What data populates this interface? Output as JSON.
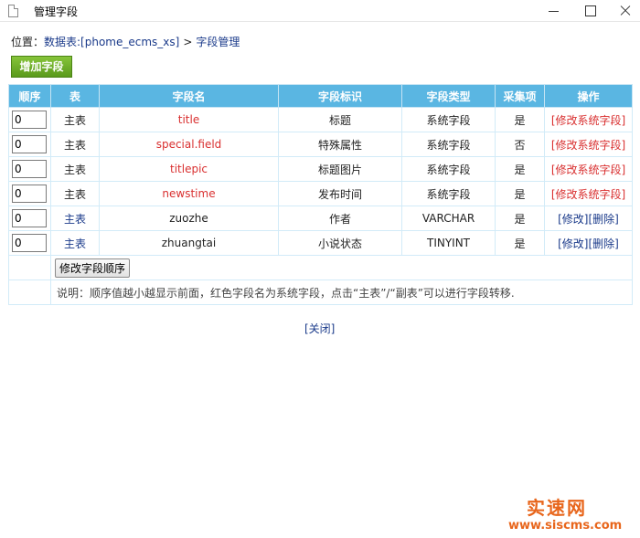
{
  "window": {
    "title": "管理字段"
  },
  "breadcrumb": {
    "prefix": "位置：",
    "db_link": "数据表:[phome_ecms_xs]",
    "separator": ">",
    "current": "字段管理"
  },
  "toolbar": {
    "add_label": "增加字段"
  },
  "table": {
    "headers": [
      "顺序",
      "表",
      "字段名",
      "字段标识",
      "字段类型",
      "采集项",
      "操作"
    ],
    "rows": [
      {
        "order": "0",
        "table": "主表",
        "name": "title",
        "label": "标题",
        "type": "系统字段",
        "collect": "是",
        "system": true,
        "op_sys": "[修改系统字段]"
      },
      {
        "order": "0",
        "table": "主表",
        "name": "special.field",
        "label": "特殊属性",
        "type": "系统字段",
        "collect": "否",
        "system": true,
        "op_sys": "[修改系统字段]"
      },
      {
        "order": "0",
        "table": "主表",
        "name": "titlepic",
        "label": "标题图片",
        "type": "系统字段",
        "collect": "是",
        "system": true,
        "op_sys": "[修改系统字段]"
      },
      {
        "order": "0",
        "table": "主表",
        "name": "newstime",
        "label": "发布时间",
        "type": "系统字段",
        "collect": "是",
        "system": true,
        "op_sys": "[修改系统字段]"
      },
      {
        "order": "0",
        "table": "主表",
        "name": "zuozhe",
        "label": "作者",
        "type": "VARCHAR",
        "collect": "是",
        "system": false,
        "op_edit": "[修改]",
        "op_delete": "[删除]"
      },
      {
        "order": "0",
        "table": "主表",
        "name": "zhuangtai",
        "label": "小说状态",
        "type": "TINYINT",
        "collect": "是",
        "system": false,
        "op_edit": "[修改]",
        "op_delete": "[删除]"
      }
    ],
    "submit_label": "修改字段顺序",
    "note": "说明：顺序值越小越显示前面，红色字段名为系统字段，点击“主表”/“副表”可以进行字段转移."
  },
  "footer": {
    "close_label": "[关闭]"
  },
  "watermark": {
    "top": "实速网",
    "bottom": "www.siscms.com"
  },
  "colors": {
    "header_bg": "#5ab6e2",
    "system_red": "#d93030",
    "link_blue": "#1a3a8a",
    "add_green": "#6aab24",
    "watermark_orange": "#e8661c"
  }
}
